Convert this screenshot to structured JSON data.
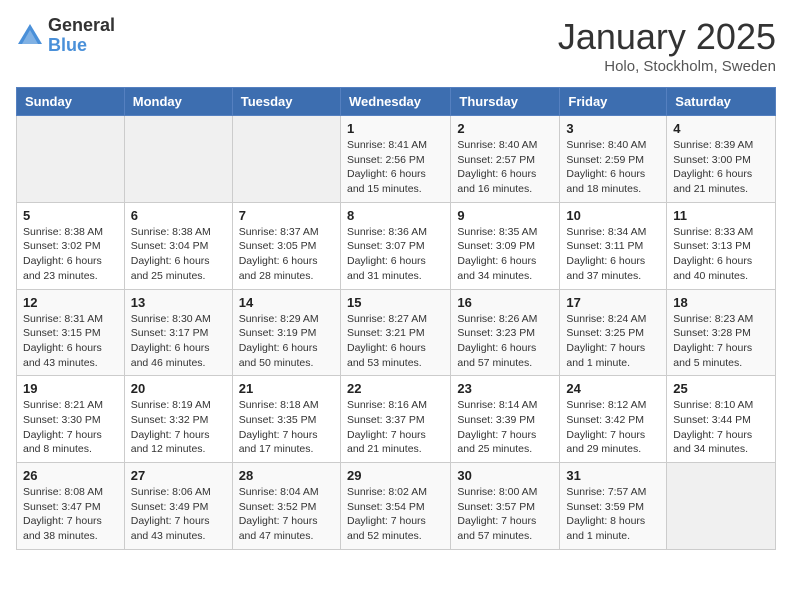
{
  "header": {
    "logo_general": "General",
    "logo_blue": "Blue",
    "title": "January 2025",
    "subtitle": "Holo, Stockholm, Sweden"
  },
  "weekdays": [
    "Sunday",
    "Monday",
    "Tuesday",
    "Wednesday",
    "Thursday",
    "Friday",
    "Saturday"
  ],
  "weeks": [
    [
      {
        "day": "",
        "info": ""
      },
      {
        "day": "",
        "info": ""
      },
      {
        "day": "",
        "info": ""
      },
      {
        "day": "1",
        "info": "Sunrise: 8:41 AM\nSunset: 2:56 PM\nDaylight: 6 hours\nand 15 minutes."
      },
      {
        "day": "2",
        "info": "Sunrise: 8:40 AM\nSunset: 2:57 PM\nDaylight: 6 hours\nand 16 minutes."
      },
      {
        "day": "3",
        "info": "Sunrise: 8:40 AM\nSunset: 2:59 PM\nDaylight: 6 hours\nand 18 minutes."
      },
      {
        "day": "4",
        "info": "Sunrise: 8:39 AM\nSunset: 3:00 PM\nDaylight: 6 hours\nand 21 minutes."
      }
    ],
    [
      {
        "day": "5",
        "info": "Sunrise: 8:38 AM\nSunset: 3:02 PM\nDaylight: 6 hours\nand 23 minutes."
      },
      {
        "day": "6",
        "info": "Sunrise: 8:38 AM\nSunset: 3:04 PM\nDaylight: 6 hours\nand 25 minutes."
      },
      {
        "day": "7",
        "info": "Sunrise: 8:37 AM\nSunset: 3:05 PM\nDaylight: 6 hours\nand 28 minutes."
      },
      {
        "day": "8",
        "info": "Sunrise: 8:36 AM\nSunset: 3:07 PM\nDaylight: 6 hours\nand 31 minutes."
      },
      {
        "day": "9",
        "info": "Sunrise: 8:35 AM\nSunset: 3:09 PM\nDaylight: 6 hours\nand 34 minutes."
      },
      {
        "day": "10",
        "info": "Sunrise: 8:34 AM\nSunset: 3:11 PM\nDaylight: 6 hours\nand 37 minutes."
      },
      {
        "day": "11",
        "info": "Sunrise: 8:33 AM\nSunset: 3:13 PM\nDaylight: 6 hours\nand 40 minutes."
      }
    ],
    [
      {
        "day": "12",
        "info": "Sunrise: 8:31 AM\nSunset: 3:15 PM\nDaylight: 6 hours\nand 43 minutes."
      },
      {
        "day": "13",
        "info": "Sunrise: 8:30 AM\nSunset: 3:17 PM\nDaylight: 6 hours\nand 46 minutes."
      },
      {
        "day": "14",
        "info": "Sunrise: 8:29 AM\nSunset: 3:19 PM\nDaylight: 6 hours\nand 50 minutes."
      },
      {
        "day": "15",
        "info": "Sunrise: 8:27 AM\nSunset: 3:21 PM\nDaylight: 6 hours\nand 53 minutes."
      },
      {
        "day": "16",
        "info": "Sunrise: 8:26 AM\nSunset: 3:23 PM\nDaylight: 6 hours\nand 57 minutes."
      },
      {
        "day": "17",
        "info": "Sunrise: 8:24 AM\nSunset: 3:25 PM\nDaylight: 7 hours\nand 1 minute."
      },
      {
        "day": "18",
        "info": "Sunrise: 8:23 AM\nSunset: 3:28 PM\nDaylight: 7 hours\nand 5 minutes."
      }
    ],
    [
      {
        "day": "19",
        "info": "Sunrise: 8:21 AM\nSunset: 3:30 PM\nDaylight: 7 hours\nand 8 minutes."
      },
      {
        "day": "20",
        "info": "Sunrise: 8:19 AM\nSunset: 3:32 PM\nDaylight: 7 hours\nand 12 minutes."
      },
      {
        "day": "21",
        "info": "Sunrise: 8:18 AM\nSunset: 3:35 PM\nDaylight: 7 hours\nand 17 minutes."
      },
      {
        "day": "22",
        "info": "Sunrise: 8:16 AM\nSunset: 3:37 PM\nDaylight: 7 hours\nand 21 minutes."
      },
      {
        "day": "23",
        "info": "Sunrise: 8:14 AM\nSunset: 3:39 PM\nDaylight: 7 hours\nand 25 minutes."
      },
      {
        "day": "24",
        "info": "Sunrise: 8:12 AM\nSunset: 3:42 PM\nDaylight: 7 hours\nand 29 minutes."
      },
      {
        "day": "25",
        "info": "Sunrise: 8:10 AM\nSunset: 3:44 PM\nDaylight: 7 hours\nand 34 minutes."
      }
    ],
    [
      {
        "day": "26",
        "info": "Sunrise: 8:08 AM\nSunset: 3:47 PM\nDaylight: 7 hours\nand 38 minutes."
      },
      {
        "day": "27",
        "info": "Sunrise: 8:06 AM\nSunset: 3:49 PM\nDaylight: 7 hours\nand 43 minutes."
      },
      {
        "day": "28",
        "info": "Sunrise: 8:04 AM\nSunset: 3:52 PM\nDaylight: 7 hours\nand 47 minutes."
      },
      {
        "day": "29",
        "info": "Sunrise: 8:02 AM\nSunset: 3:54 PM\nDaylight: 7 hours\nand 52 minutes."
      },
      {
        "day": "30",
        "info": "Sunrise: 8:00 AM\nSunset: 3:57 PM\nDaylight: 7 hours\nand 57 minutes."
      },
      {
        "day": "31",
        "info": "Sunrise: 7:57 AM\nSunset: 3:59 PM\nDaylight: 8 hours\nand 1 minute."
      },
      {
        "day": "",
        "info": ""
      }
    ]
  ]
}
